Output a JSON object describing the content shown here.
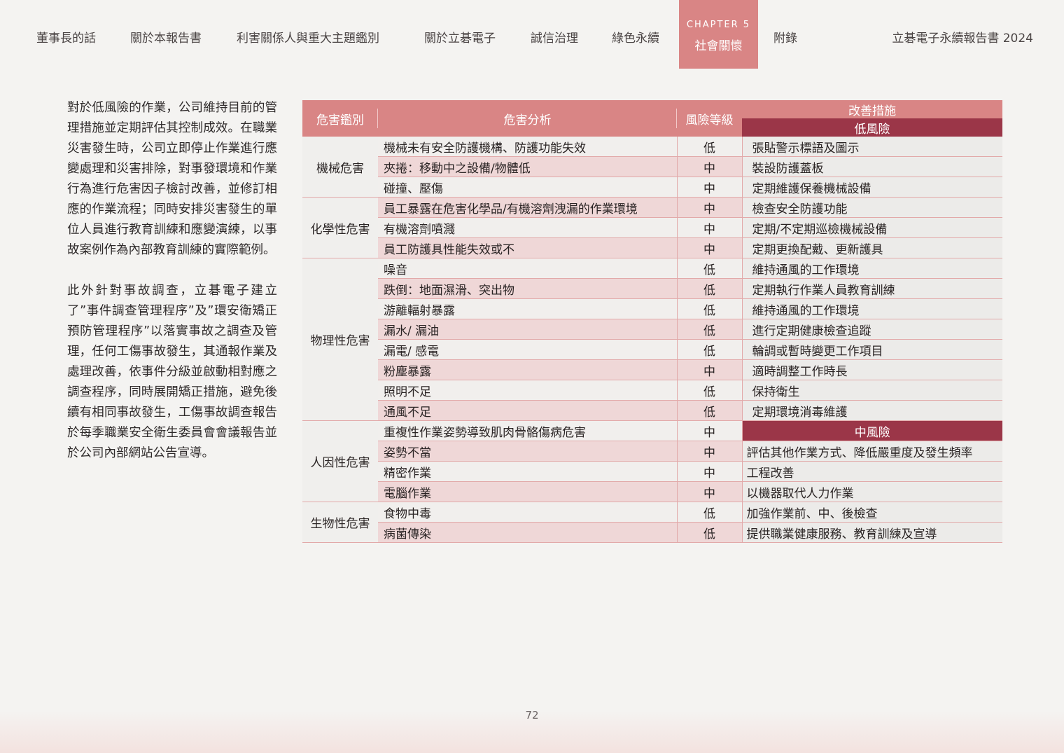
{
  "nav": {
    "items": [
      "董事長的話",
      "關於本報告書",
      "利害關係人與重大主題鑑別",
      "關於立碁電子",
      "誠信治理",
      "綠色永續"
    ],
    "chapter_label": "CHAPTER 5",
    "chapter_title": "社會關懷",
    "appendix": "附錄",
    "report_title": "立碁電子永續報告書 2024",
    "active_color": "#d98585"
  },
  "body": {
    "paragraph1": "對於低風險的作業，公司維持目前的管理措施並定期評估其控制成效。在職業災害發生時，公司立即停止作業進行應變處理和災害排除，對事發環境和作業行為進行危害因子檢討改善，並修訂相應的作業流程；同時安排災害發生的單位人員進行教育訓練和應變演練，以事故案例作為內部教育訓練的實際範例。",
    "paragraph2": "此外針對事故調查，立碁電子建立了”事件調查管理程序”及”環安衛矯正預防管理程序”以落實事故之調查及管理，任何工傷事故發生，其通報作業及處理改善，依事件分級並啟動相對應之調查程序，同時展開矯正措施，避免後續有相同事故發生，工傷事故調查報告於每季職業安全衛生委員會會議報告並於公司內部網站公告宣導。"
  },
  "table": {
    "headers": {
      "category": "危害鑑別",
      "analysis": "危害分析",
      "level": "風險等級",
      "measures": "改善措施",
      "low_band": "低風險",
      "mid_band": "中風險"
    },
    "categories": {
      "mechanical": "機械危害",
      "chemical": "化學性危害",
      "physical": "物理性危害",
      "human": "人因性危害",
      "biological": "生物性危害"
    },
    "rows": [
      {
        "analysis": "機械未有安全防護機構、防護功能失效",
        "level": "低",
        "measure": "張貼警示標語及圖示"
      },
      {
        "analysis": "夾捲：移動中之設備/物體低",
        "level": "中",
        "measure": "裝設防護蓋板"
      },
      {
        "analysis": "碰撞、壓傷",
        "level": "中",
        "measure": "定期維護保養機械設備"
      },
      {
        "analysis": "員工暴露在危害化學品/有機溶劑洩漏的作業環境",
        "level": "中",
        "measure": "檢查安全防護功能"
      },
      {
        "analysis": "有機溶劑噴濺",
        "level": "中",
        "measure": "定期/不定期巡檢機械設備"
      },
      {
        "analysis": "員工防護具性能失效或不",
        "level": "中",
        "measure": "定期更換配戴、更新護具"
      },
      {
        "analysis": "噪音",
        "level": "低",
        "measure": "維持通風的工作環境"
      },
      {
        "analysis": "跌倒：地面濕滑、突出物",
        "level": "低",
        "measure": "定期執行作業人員教育訓練"
      },
      {
        "analysis": "游離輻射暴露",
        "level": "低",
        "measure": "維持通風的工作環境"
      },
      {
        "analysis": "漏水/ 漏油",
        "level": "低",
        "measure": "進行定期健康檢查追蹤"
      },
      {
        "analysis": "漏電/ 感電",
        "level": "低",
        "measure": "輪調或暫時變更工作項目"
      },
      {
        "analysis": "粉塵暴露",
        "level": "中",
        "measure": "適時調整工作時長"
      },
      {
        "analysis": "照明不足",
        "level": "低",
        "measure": "保持衛生"
      },
      {
        "analysis": "通風不足",
        "level": "低",
        "measure": "定期環境消毒維護"
      },
      {
        "analysis": "重複性作業姿勢導致肌肉骨骼傷病危害",
        "level": "中",
        "measure": ""
      },
      {
        "analysis": "姿勢不當",
        "level": "中",
        "measure": "評估其他作業方式、降低嚴重度及發生頻率"
      },
      {
        "analysis": "精密作業",
        "level": "中",
        "measure": "工程改善"
      },
      {
        "analysis": "電腦作業",
        "level": "中",
        "measure": "以機器取代人力作業"
      },
      {
        "analysis": "食物中毒",
        "level": "低",
        "measure": "加強作業前、中、後檢查"
      },
      {
        "analysis": "病菌傳染",
        "level": "低",
        "measure": "提供職業健康服務、教育訓練及宣導"
      }
    ]
  },
  "page_number": "72"
}
